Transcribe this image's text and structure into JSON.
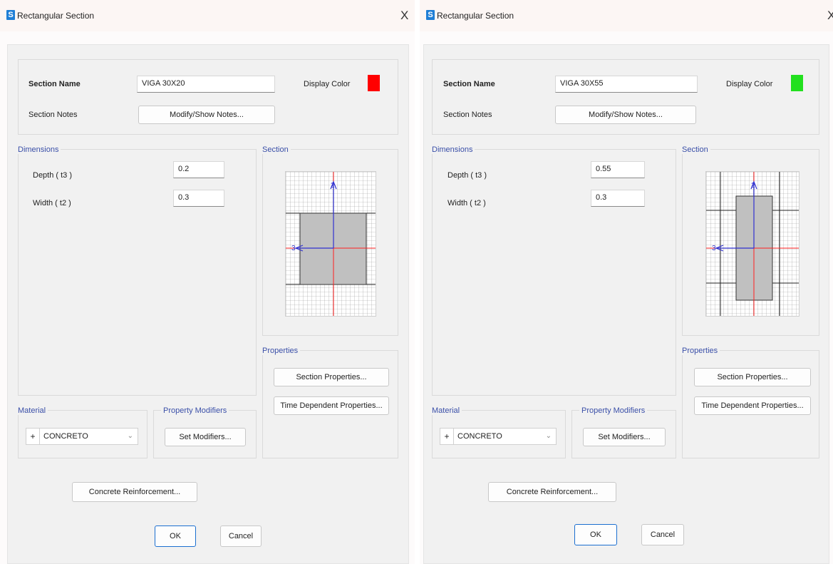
{
  "dialogs": [
    {
      "title": "Rectangular Section",
      "close_label": "X",
      "section_name_label": "Section Name",
      "section_name_value": "VIGA 30X20",
      "display_color_label": "Display Color",
      "display_color": "#ff0000",
      "section_notes_label": "Section Notes",
      "modify_notes_button": "Modify/Show Notes...",
      "dimensions_title": "Dimensions",
      "depth_label": "Depth ( t3 )",
      "depth_value": "0.2",
      "width_label": "Width ( t2 )",
      "width_value": "0.3",
      "section_title": "Section",
      "properties_title": "Properties",
      "section_properties_button": "Section Properties...",
      "time_dependent_button": "Time Dependent Properties...",
      "material_title": "Material",
      "material_value": "CONCRETO",
      "material_add": "+",
      "modifiers_title": "Property Modifiers",
      "set_modifiers_button": "Set Modifiers...",
      "concrete_reinf_button": "Concrete Reinforcement...",
      "ok_button": "OK",
      "cancel_button": "Cancel",
      "axis2_label": "2",
      "axis3_label": "3"
    },
    {
      "title": "Rectangular Section",
      "close_label": "X",
      "section_name_label": "Section Name",
      "section_name_value": "VIGA 30X55",
      "display_color_label": "Display Color",
      "display_color": "#22e01e",
      "section_notes_label": "Section Notes",
      "modify_notes_button": "Modify/Show Notes...",
      "dimensions_title": "Dimensions",
      "depth_label": "Depth ( t3 )",
      "depth_value": "0.55",
      "width_label": "Width ( t2 )",
      "width_value": "0.3",
      "section_title": "Section",
      "properties_title": "Properties",
      "section_properties_button": "Section Properties...",
      "time_dependent_button": "Time Dependent Properties...",
      "material_title": "Material",
      "material_value": "CONCRETO",
      "material_add": "+",
      "modifiers_title": "Property Modifiers",
      "set_modifiers_button": "Set Modifiers...",
      "concrete_reinf_button": "Concrete Reinforcement...",
      "ok_button": "OK",
      "cancel_button": "Cancel",
      "axis2_label": "2",
      "axis3_label": "3"
    }
  ]
}
